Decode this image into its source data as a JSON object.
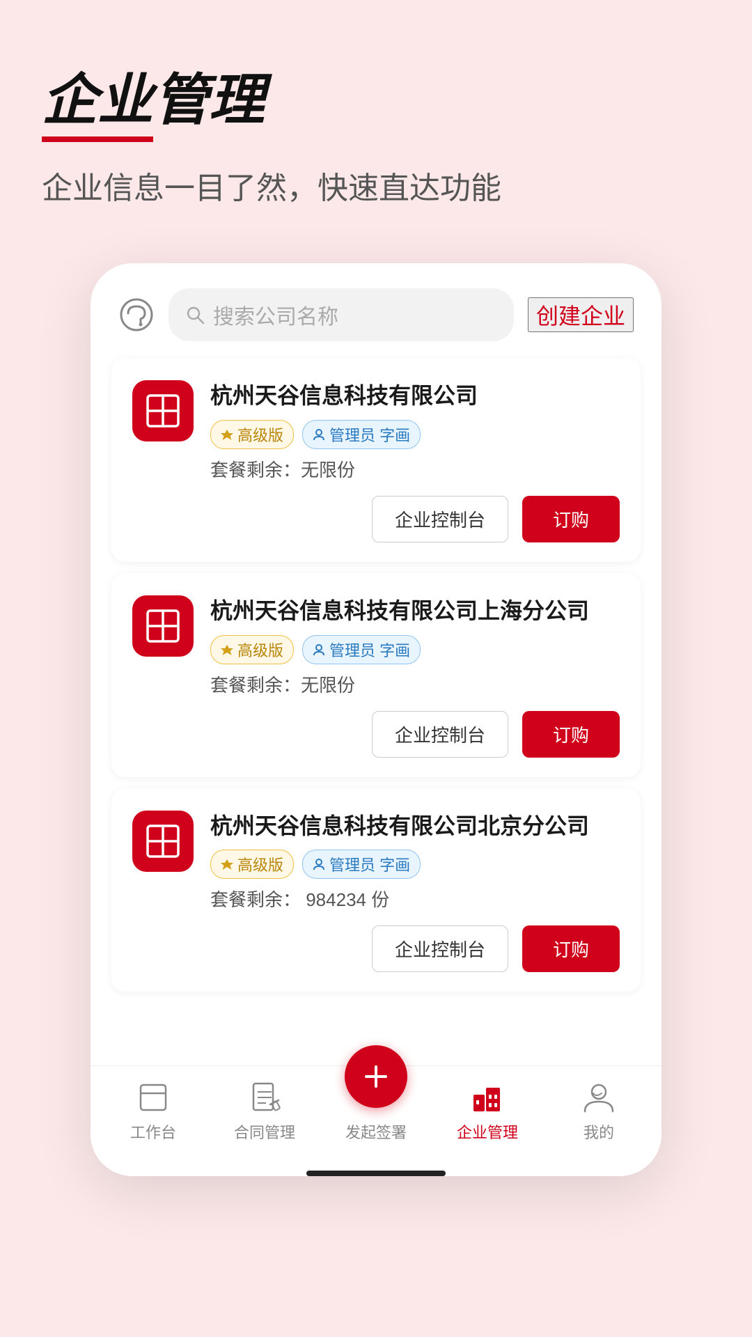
{
  "header": {
    "title": "企业管理",
    "subtitle": "企业信息一目了然，快速直达功能"
  },
  "search": {
    "placeholder": "搜索公司名称",
    "create_label": "创建企业"
  },
  "companies": [
    {
      "id": 1,
      "name": "杭州天谷信息科技有限公司",
      "tier": "高级版",
      "role": "管理员 字画",
      "quota_label": "套餐剩余：",
      "quota_value": "无限份"
    },
    {
      "id": 2,
      "name": "杭州天谷信息科技有限公司上海分公司",
      "tier": "高级版",
      "role": "管理员 字画",
      "quota_label": "套餐剩余：",
      "quota_value": "无限份"
    },
    {
      "id": 3,
      "name": "杭州天谷信息科技有限公司北京分公司",
      "tier": "高级版",
      "role": "管理员 字画",
      "quota_label": "套餐剩余：",
      "quota_value": "984234 份"
    }
  ],
  "buttons": {
    "console": "企业控制台",
    "purchase": "订购"
  },
  "nav": {
    "items": [
      {
        "id": "workbench",
        "label": "工作台",
        "active": false
      },
      {
        "id": "contract",
        "label": "合同管理",
        "active": false
      },
      {
        "id": "sign",
        "label": "发起签署",
        "active": false,
        "fab": true
      },
      {
        "id": "enterprise",
        "label": "企业管理",
        "active": true
      },
      {
        "id": "mine",
        "label": "我的",
        "active": false
      }
    ]
  },
  "colors": {
    "brand": "#d0021b",
    "gold": "#b8860b",
    "blue": "#2a7ac0"
  }
}
